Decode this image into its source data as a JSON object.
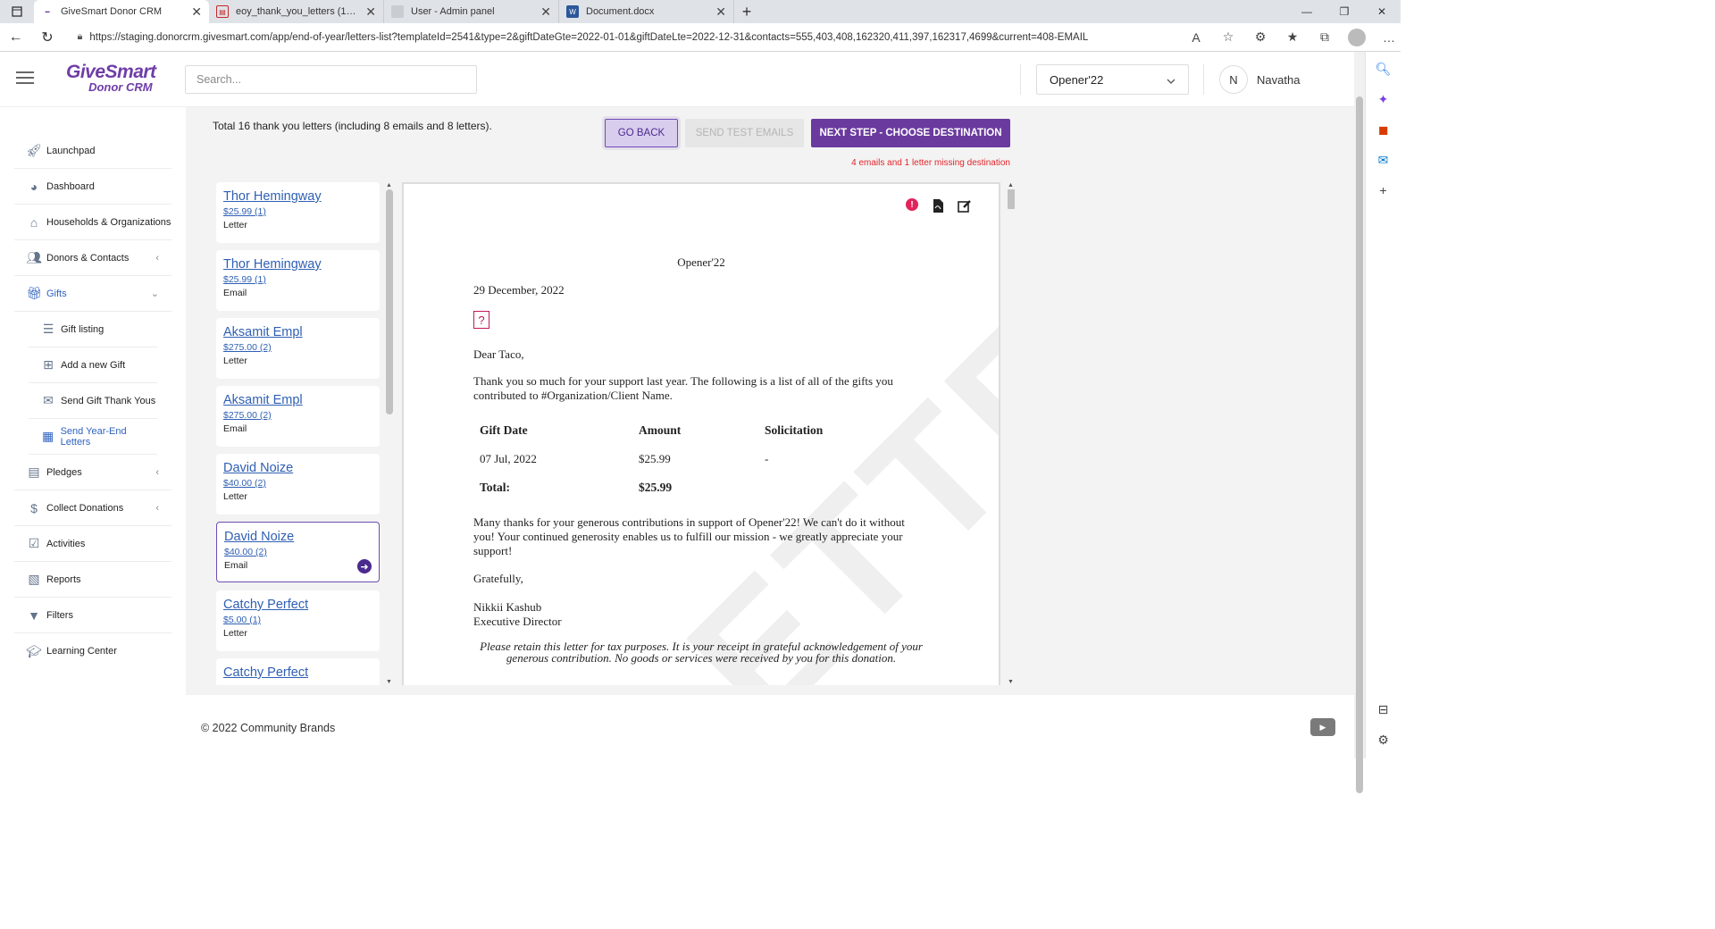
{
  "browser": {
    "tabs": [
      {
        "title": "GiveSmart Donor CRM",
        "active": true
      },
      {
        "title": "eoy_thank_you_letters (1).pdf",
        "active": false
      },
      {
        "title": "User - Admin panel",
        "active": false
      },
      {
        "title": "Document.docx",
        "active": false
      }
    ],
    "url": "https://staging.donorcrm.givesmart.com/app/end-of-year/letters-list?templateId=2541&type=2&giftDateGte=2022-01-01&giftDateLte=2022-12-31&contacts=555,403,408,162320,411,397,162317,4699&current=408-EMAIL"
  },
  "header": {
    "logo_line1": "GiveSmart",
    "logo_line2": "Donor CRM",
    "search_placeholder": "Search...",
    "org_selected": "Opener'22",
    "user_initial": "N",
    "user_name": "Navatha"
  },
  "nav": {
    "items": [
      {
        "label": "Launchpad",
        "icon": "rocket-icon"
      },
      {
        "label": "Dashboard",
        "icon": "dashboard-icon"
      },
      {
        "label": "Households & Organizations",
        "icon": "home-icon"
      },
      {
        "label": "Donors & Contacts",
        "icon": "users-icon"
      },
      {
        "label": "Gifts",
        "icon": "gift-icon"
      },
      {
        "label": "Gift listing",
        "icon": "list-icon"
      },
      {
        "label": "Add a new Gift",
        "icon": "plus-square-icon"
      },
      {
        "label": "Send Gift Thank Yous",
        "icon": "envelope-icon"
      },
      {
        "label": "Send Year-End Letters",
        "icon": "calendar-icon"
      },
      {
        "label": "Pledges",
        "icon": "pledge-doc-icon"
      },
      {
        "label": "Collect Donations",
        "icon": "donation-hand-icon"
      },
      {
        "label": "Activities",
        "icon": "checklist-icon"
      },
      {
        "label": "Reports",
        "icon": "report-icon"
      },
      {
        "label": "Filters",
        "icon": "filter-icon"
      },
      {
        "label": "Learning Center",
        "icon": "graduation-cap-icon"
      }
    ]
  },
  "main": {
    "total_text": "Total 16 thank you letters (including 8 emails and 8 letters).",
    "btn_back": "GO BACK",
    "btn_test": "SEND TEST EMAILS",
    "btn_next": "NEXT STEP - CHOOSE DESTINATION",
    "missing_text": "4 emails and 1 letter missing destination",
    "letters": [
      {
        "name": "Thor Hemingway",
        "amount": "$25.99 (1)",
        "type": "Letter"
      },
      {
        "name": "Thor Hemingway",
        "amount": "$25.99 (1)",
        "type": "Email"
      },
      {
        "name": "Aksamit Empl",
        "amount": "$275.00 (2)",
        "type": "Letter"
      },
      {
        "name": "Aksamit Empl",
        "amount": "$275.00 (2)",
        "type": "Email"
      },
      {
        "name": "David Noize",
        "amount": "$40.00 (2)",
        "type": "Letter"
      },
      {
        "name": "David Noize",
        "amount": "$40.00 (2)",
        "type": "Email"
      },
      {
        "name": "Catchy Perfect",
        "amount": "$5.00 (1)",
        "type": "Letter"
      },
      {
        "name": "Catchy Perfect",
        "amount": "",
        "type": ""
      }
    ]
  },
  "preview": {
    "watermark": "LETTER",
    "org": "Opener'22",
    "date": "29 December, 2022",
    "placeholder_glyph": "?",
    "greeting": "Dear Taco,",
    "para1": "Thank you so much for your support last year. The following is a list of all of the gifts you contributed to #Organization/Client Name.",
    "table": {
      "col_date": "Gift Date",
      "col_amount": "Amount",
      "col_solicitation": "Solicitation",
      "row_date": "07 Jul, 2022",
      "row_amount": "$25.99",
      "row_solicitation": "-",
      "total_label": "Total:",
      "total_value": "$25.99"
    },
    "para2": "Many thanks for your generous contributions in support of Opener'22! We can't do it without you! Your continued generosity enables us to fulfill our mission - we greatly appreciate your support!",
    "closing": "Gratefully,",
    "signer_name": "Nikkii Kashub",
    "signer_title": "Executive Director",
    "footer_note": "Please retain this letter for tax purposes. It is your receipt in grateful acknowledgement of your generous contribution. No goods or services were received by you for this donation."
  },
  "footer": {
    "copyright": "© 2022 Community Brands"
  },
  "colors": {
    "brand_purple": "#6a3a9f",
    "link_blue": "#2f5fb3",
    "error_red": "#e0262c"
  }
}
